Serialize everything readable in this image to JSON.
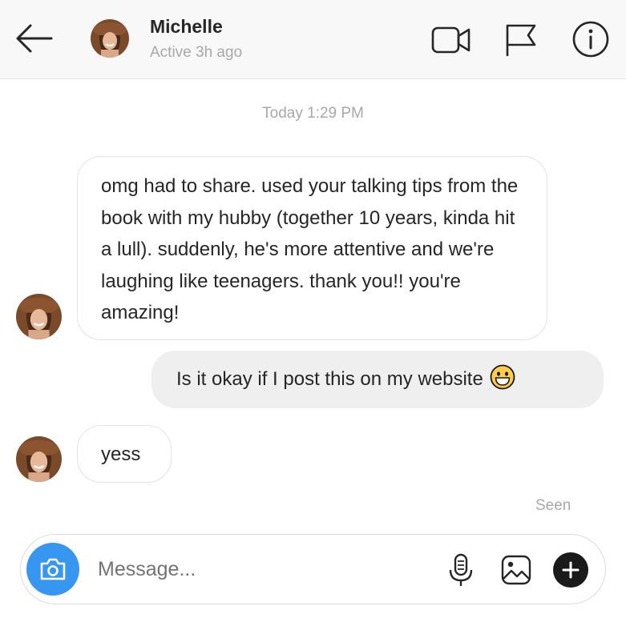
{
  "header": {
    "contact_name": "Michelle",
    "contact_status": "Active 3h ago",
    "icons": [
      "back-arrow-icon",
      "video-camera-icon",
      "flag-icon",
      "info-icon"
    ]
  },
  "conversation": {
    "timestamp": "Today 1:29 PM",
    "messages": [
      {
        "direction": "received",
        "text": "omg had to share. used your talking tips from the book with my hubby (together 10 years, kinda hit a lull). suddenly, he's more attentive and we're laughing like teenagers. thank you!! you're amazing!"
      },
      {
        "direction": "sent",
        "text": "Is it okay if I post this on my website",
        "emoji": "grinning-face-icon"
      },
      {
        "direction": "received",
        "text": "yess"
      }
    ],
    "seen_label": "Seen"
  },
  "composer": {
    "placeholder": "Message...",
    "icons": [
      "camera-icon",
      "microphone-icon",
      "image-icon",
      "plus-icon"
    ]
  },
  "colors": {
    "accent": "#3797f0",
    "header_bg": "#f8f8f8",
    "sent_bubble": "#efefef",
    "muted_text": "#a8a8a8"
  }
}
